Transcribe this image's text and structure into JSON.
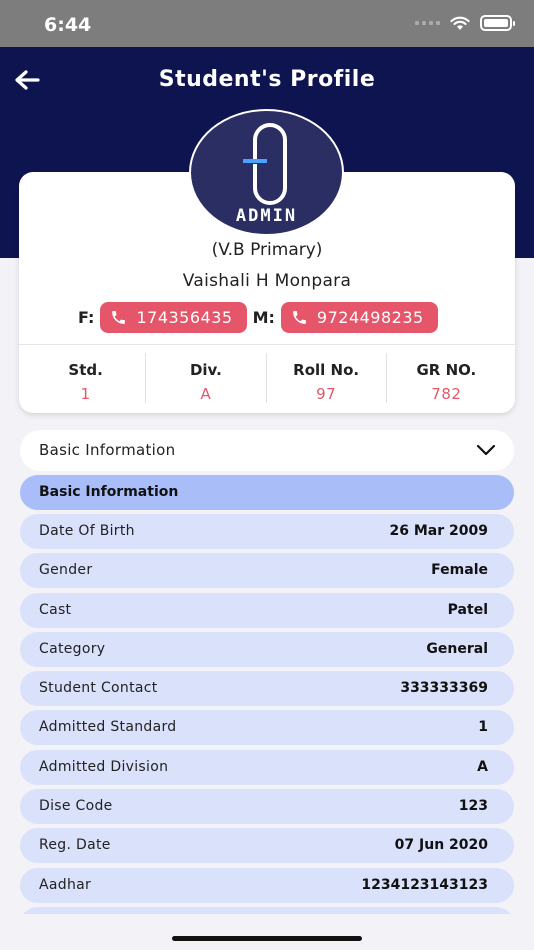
{
  "status": {
    "time": "6:44"
  },
  "header": {
    "title": "Student's Profile"
  },
  "avatar": {
    "text": "ADMIN"
  },
  "student": {
    "school": "(V.B Primary)",
    "name": "Vaishali H Monpara",
    "father_label": "F:",
    "father_phone": "174356435",
    "mother_label": "M:",
    "mother_phone": "9724498235"
  },
  "stats": [
    {
      "label": "Std.",
      "value": "1"
    },
    {
      "label": "Div.",
      "value": "A"
    },
    {
      "label": "Roll No.",
      "value": "97"
    },
    {
      "label": "GR NO.",
      "value": "782"
    }
  ],
  "dropdown": {
    "selected": "Basic Information"
  },
  "section": {
    "title": "Basic Information"
  },
  "rows": [
    {
      "label": "Date Of Birth",
      "value": "26 Mar 2009"
    },
    {
      "label": "Gender",
      "value": "Female"
    },
    {
      "label": "Cast",
      "value": "Patel"
    },
    {
      "label": "Category",
      "value": "General"
    },
    {
      "label": "Student Contact",
      "value": "333333369"
    },
    {
      "label": "Admitted Standard",
      "value": "1"
    },
    {
      "label": "Admitted Division",
      "value": "A"
    },
    {
      "label": "Dise Code",
      "value": "123"
    },
    {
      "label": "Reg. Date",
      "value": "07 Jun 2020"
    },
    {
      "label": "Aadhar",
      "value": "1234123143123"
    }
  ],
  "colors": {
    "header_bg": "#0e144f",
    "accent": "#e5566a",
    "section_header": "#a9bdf8",
    "row_bg": "#d9e1fb"
  }
}
